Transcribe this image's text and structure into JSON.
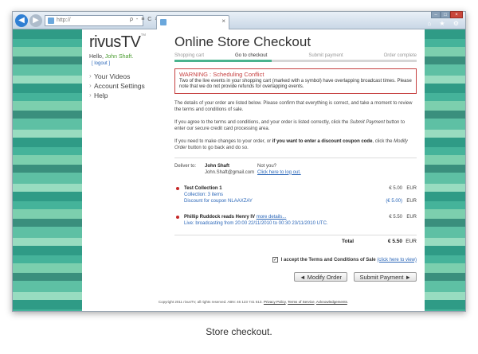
{
  "browser": {
    "address": "http://",
    "address_controls": "ρ - ≡ C ×",
    "tab_close": "×",
    "caption_buttons": [
      "–",
      "□",
      "×"
    ],
    "tools": "⌂ ★ ⚙"
  },
  "site": {
    "logo": "rivusTV",
    "logo_mark": "™",
    "hello_prefix": "Hello,",
    "user_name": "John Shaft.",
    "logout": "[ logout ]",
    "nav": [
      "Your Videos",
      "Account Settings",
      "Help"
    ]
  },
  "checkout": {
    "title": "Online Store Checkout",
    "steps": [
      "Shopping cart",
      "Go to checkout",
      "Submit payment",
      "Order complete"
    ],
    "progress_fraction": 0.4,
    "warning_title": "WARNING : Scheduling Conflict",
    "warning_text": "Two of the live events in your shopping cart (marked with a symbol) have overlapping broadcast times. Please note that we do not provide refunds for overlapping events.",
    "p1": "The details of your order are listed below. Please confirm that everything is correct, and take a moment to review the terms and conditions of sale.",
    "p2_a": "If you agree to the terms and conditions, and your order is listed correctly, click the",
    "p2_submit": "Submit Payment",
    "p2_b": "button to enter our secure credit card processing area.",
    "p3_a": "If you need to make changes to your order, or",
    "p3_bold": "if you want to enter a discount coupon code",
    "p3_b": ", click the",
    "p3_modify": "Modify Order",
    "p3_c": "button to go back and do so.",
    "deliver_label": "Deliver to:",
    "deliver_name": "John Shaft",
    "deliver_email": "John.Shaft@gmail.com",
    "not_you": "Not you?",
    "logout_link": "Click here to log out.",
    "items": [
      {
        "title": "Test Collection 1",
        "line2": "Collection: 3 items",
        "line3": "Discount for coupon NLAAXZAY",
        "price": "€ 5.00",
        "price_cur": "EUR",
        "discount": "(€ 5.00)",
        "discount_cur": "EUR"
      },
      {
        "title": "Phillip Ruddock reads Henry IV",
        "more": "more details...",
        "line2": "Live: broadcasting from 20:00 22/11/2010 to 00:30 23/11/2010 UTC.",
        "price": "€ 5.50",
        "price_cur": "EUR"
      }
    ],
    "total_label": "Total",
    "total_value": "€ 5.50",
    "total_cur": "EUR",
    "terms_check": "✓",
    "terms_text": "I accept the Terms and Conditions of Sale",
    "terms_link": "(click here to view)",
    "modify_btn": "◄ Modify Order",
    "submit_btn": "Submit Payment ►",
    "footer": "Copyright 2011 rivusTV, all rights reserved. ABN: 46 123 741 613.",
    "footer_links": [
      "Privacy Policy",
      "Terms of Service",
      "Acknowledgements"
    ]
  },
  "caption": "Store checkout."
}
